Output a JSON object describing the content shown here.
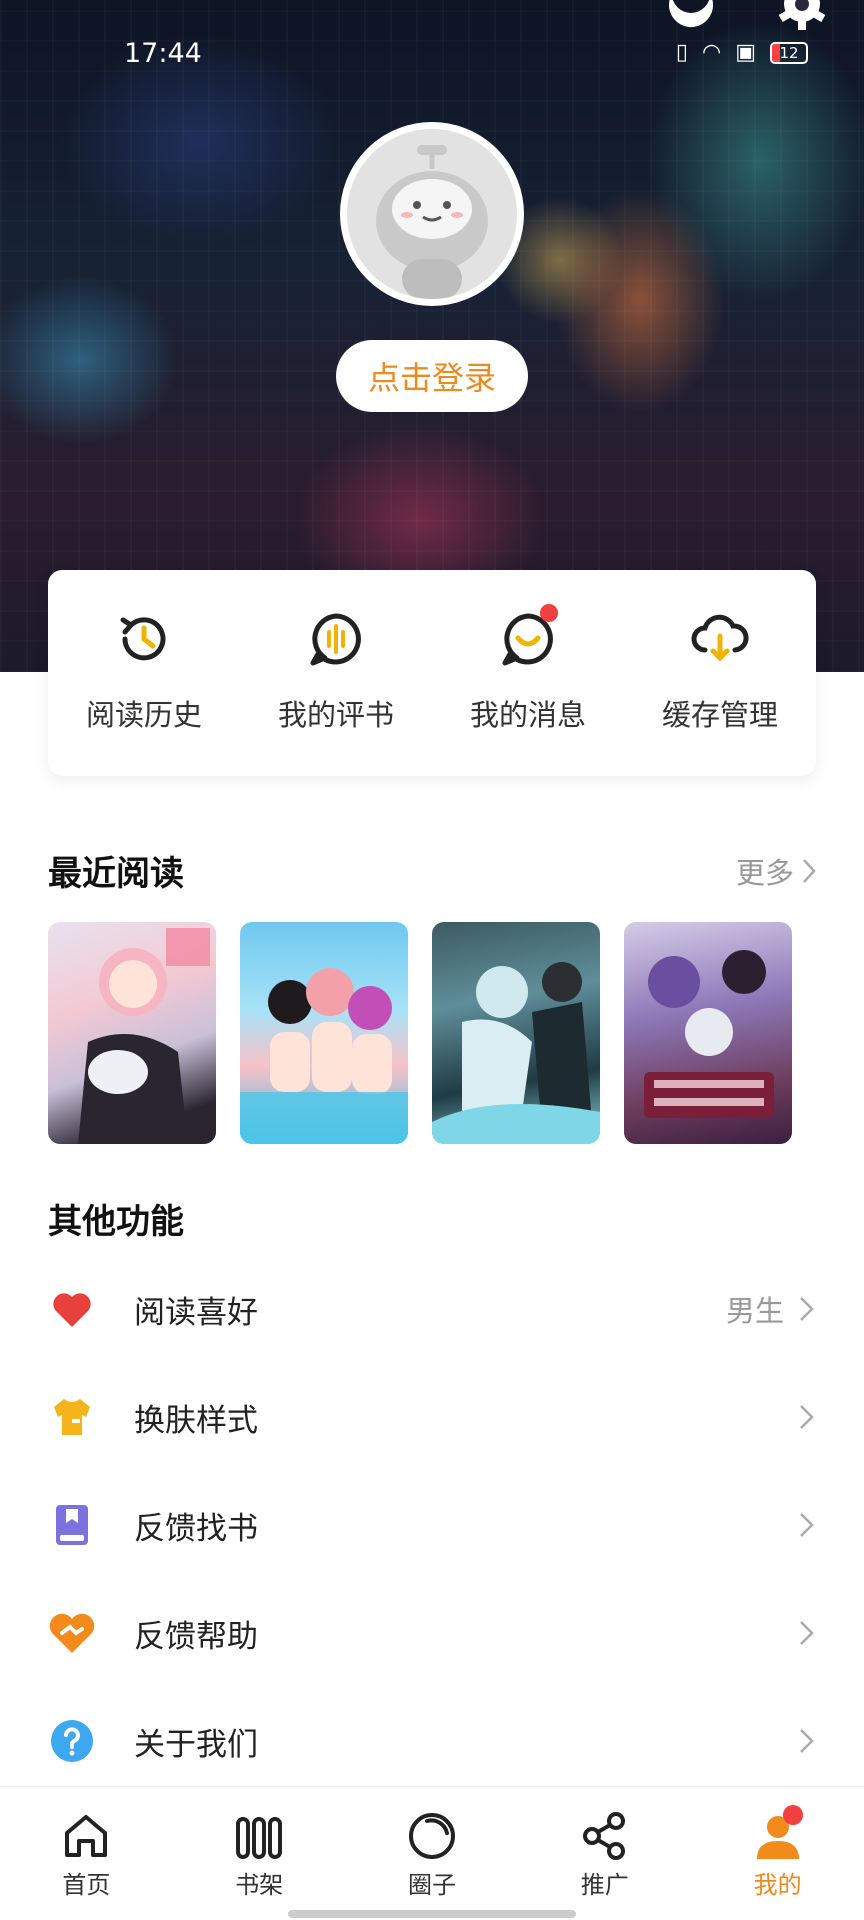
{
  "status_bar": {
    "time": "17:44",
    "battery": "12"
  },
  "profile": {
    "login_label": "点击登录"
  },
  "quick_actions": [
    {
      "label": "阅读历史",
      "icon": "history-icon"
    },
    {
      "label": "我的评书",
      "icon": "comment-book-icon"
    },
    {
      "label": "我的消息",
      "icon": "message-icon",
      "has_dot": true
    },
    {
      "label": "缓存管理",
      "icon": "cloud-download-icon"
    }
  ],
  "recent": {
    "title": "最近阅读",
    "more_label": "更多"
  },
  "other": {
    "title": "其他功能",
    "items": [
      {
        "label": "阅读喜好",
        "value": "男生",
        "icon": "heart-icon"
      },
      {
        "label": "换肤样式",
        "icon": "tshirt-icon"
      },
      {
        "label": "反馈找书",
        "icon": "book-icon"
      },
      {
        "label": "反馈帮助",
        "icon": "help-handshake-icon"
      },
      {
        "label": "关于我们",
        "icon": "question-icon"
      }
    ]
  },
  "tabs": [
    {
      "label": "首页",
      "icon": "home-icon"
    },
    {
      "label": "书架",
      "icon": "bookshelf-icon"
    },
    {
      "label": "圈子",
      "icon": "circle-icon"
    },
    {
      "label": "推广",
      "icon": "share-icon"
    },
    {
      "label": "我的",
      "icon": "profile-icon",
      "active": true
    }
  ],
  "colors": {
    "accent": "#f08a1c",
    "dot": "#f04040"
  }
}
